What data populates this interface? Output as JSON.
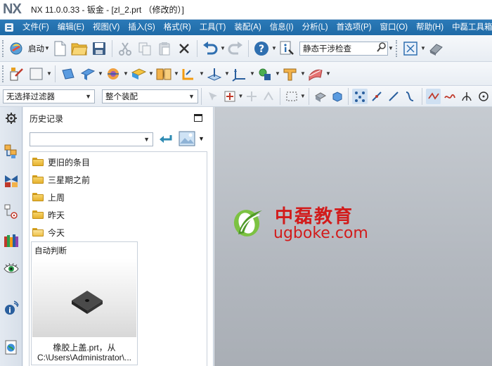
{
  "window": {
    "logo": "NX",
    "title": "NX 11.0.0.33 - 钣金 - [zl_2.prt （修改的）]"
  },
  "menu": {
    "items": [
      "文件(F)",
      "编辑(E)",
      "视图(V)",
      "插入(S)",
      "格式(R)",
      "工具(T)",
      "装配(A)",
      "信息(I)",
      "分析(L)",
      "首选项(P)",
      "窗口(O)",
      "帮助(H)",
      "中磊工具箱"
    ]
  },
  "toolbar1": {
    "start_label": "启动",
    "search_text": "静态干涉检查",
    "icons": [
      "start-icon",
      "new-file-icon",
      "open-folder-icon",
      "save-icon",
      "cut-icon",
      "copy-icon",
      "paste-icon",
      "delete-icon",
      "undo-icon",
      "redo-icon",
      "help-icon",
      "info-icon",
      "search-icon",
      "fit-view-icon",
      "render-style-icon"
    ]
  },
  "toolbar3": {
    "filter_value": "无选择过滤器",
    "scope_value": "整个装配"
  },
  "history": {
    "title": "历史记录",
    "items": [
      "更旧的条目",
      "三星期之前",
      "上周",
      "昨天",
      "今天"
    ],
    "preview_title": "自动判断",
    "preview_caption_1": "橡胶上盖.prt，从",
    "preview_caption_2": "C:\\Users\\Administrator\\..."
  },
  "watermark": {
    "cn": "中磊教育",
    "url": "ugboke.com"
  },
  "colors": {
    "menubar": "#1f6aa6",
    "accent": "#d21b1b",
    "graphics_bg": "#b8bdc4"
  }
}
